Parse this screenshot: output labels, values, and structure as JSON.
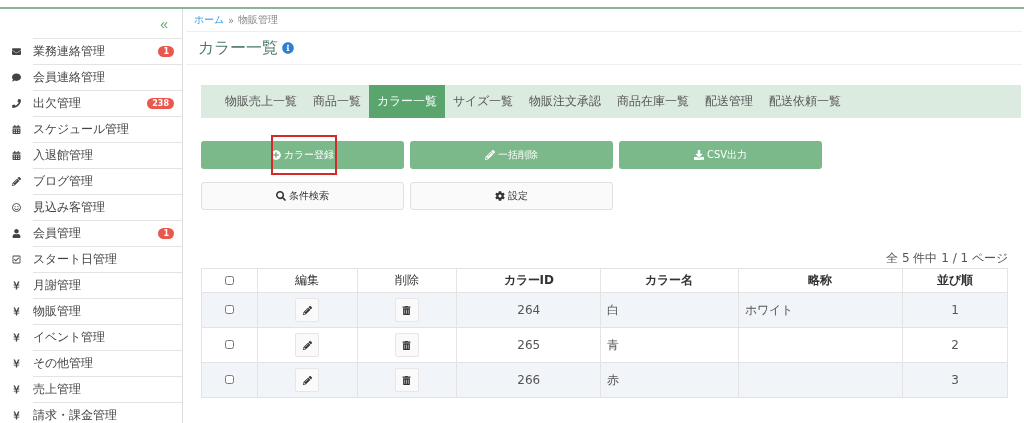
{
  "sidebar": {
    "collapse": "«",
    "items": [
      {
        "label": "業務連絡管理",
        "badge": "1"
      },
      {
        "label": "会員連絡管理"
      },
      {
        "label": "出欠管理",
        "badge": "238"
      },
      {
        "label": "スケジュール管理"
      },
      {
        "label": "入退館管理"
      },
      {
        "label": "ブログ管理"
      },
      {
        "label": "見込み客管理"
      },
      {
        "label": "会員管理",
        "badge": "1"
      },
      {
        "label": "スタート日管理"
      },
      {
        "label": "月謝管理"
      },
      {
        "label": "物販管理"
      },
      {
        "label": "イベント管理"
      },
      {
        "label": "その他管理"
      },
      {
        "label": "売上管理"
      },
      {
        "label": "請求・課金管理"
      }
    ]
  },
  "breadcrumb": {
    "home": "ホーム",
    "separator": "»",
    "current": "物販管理"
  },
  "title": "カラー一覧",
  "tabs": [
    {
      "label": "物販売上一覧",
      "selected": false
    },
    {
      "label": "商品一覧",
      "selected": false
    },
    {
      "label": "カラー一覧",
      "selected": true
    },
    {
      "label": "サイズ一覧",
      "selected": false
    },
    {
      "label": "物販注文承認",
      "selected": false
    },
    {
      "label": "商品在庫一覧",
      "selected": false
    },
    {
      "label": "配送管理",
      "selected": false
    },
    {
      "label": "配送依頼一覧",
      "selected": false
    }
  ],
  "actions": [
    {
      "label": "カラー登録",
      "kind": "primary",
      "highlighted": true
    },
    {
      "label": "一括削除",
      "kind": "primary",
      "highlighted": false
    },
    {
      "label": "CSV出力",
      "kind": "primary",
      "highlighted": false
    },
    {
      "label": "条件検索",
      "kind": "default",
      "highlighted": false
    },
    {
      "label": "設定",
      "kind": "default",
      "highlighted": false
    }
  ],
  "pagination": "全 5 件中 1 / 1 ページ",
  "table": {
    "select_all_checked": false,
    "columns": [
      "編集",
      "削除",
      "カラーID",
      "カラー名",
      "略称",
      "並び順"
    ],
    "rows": [
      {
        "checked": false,
        "id": "264",
        "name": "白",
        "short": "ホワイト",
        "order": "1"
      },
      {
        "checked": false,
        "id": "265",
        "name": "青",
        "short": "",
        "order": "2"
      },
      {
        "checked": false,
        "id": "266",
        "name": "赤",
        "short": "",
        "order": "3"
      }
    ]
  }
}
